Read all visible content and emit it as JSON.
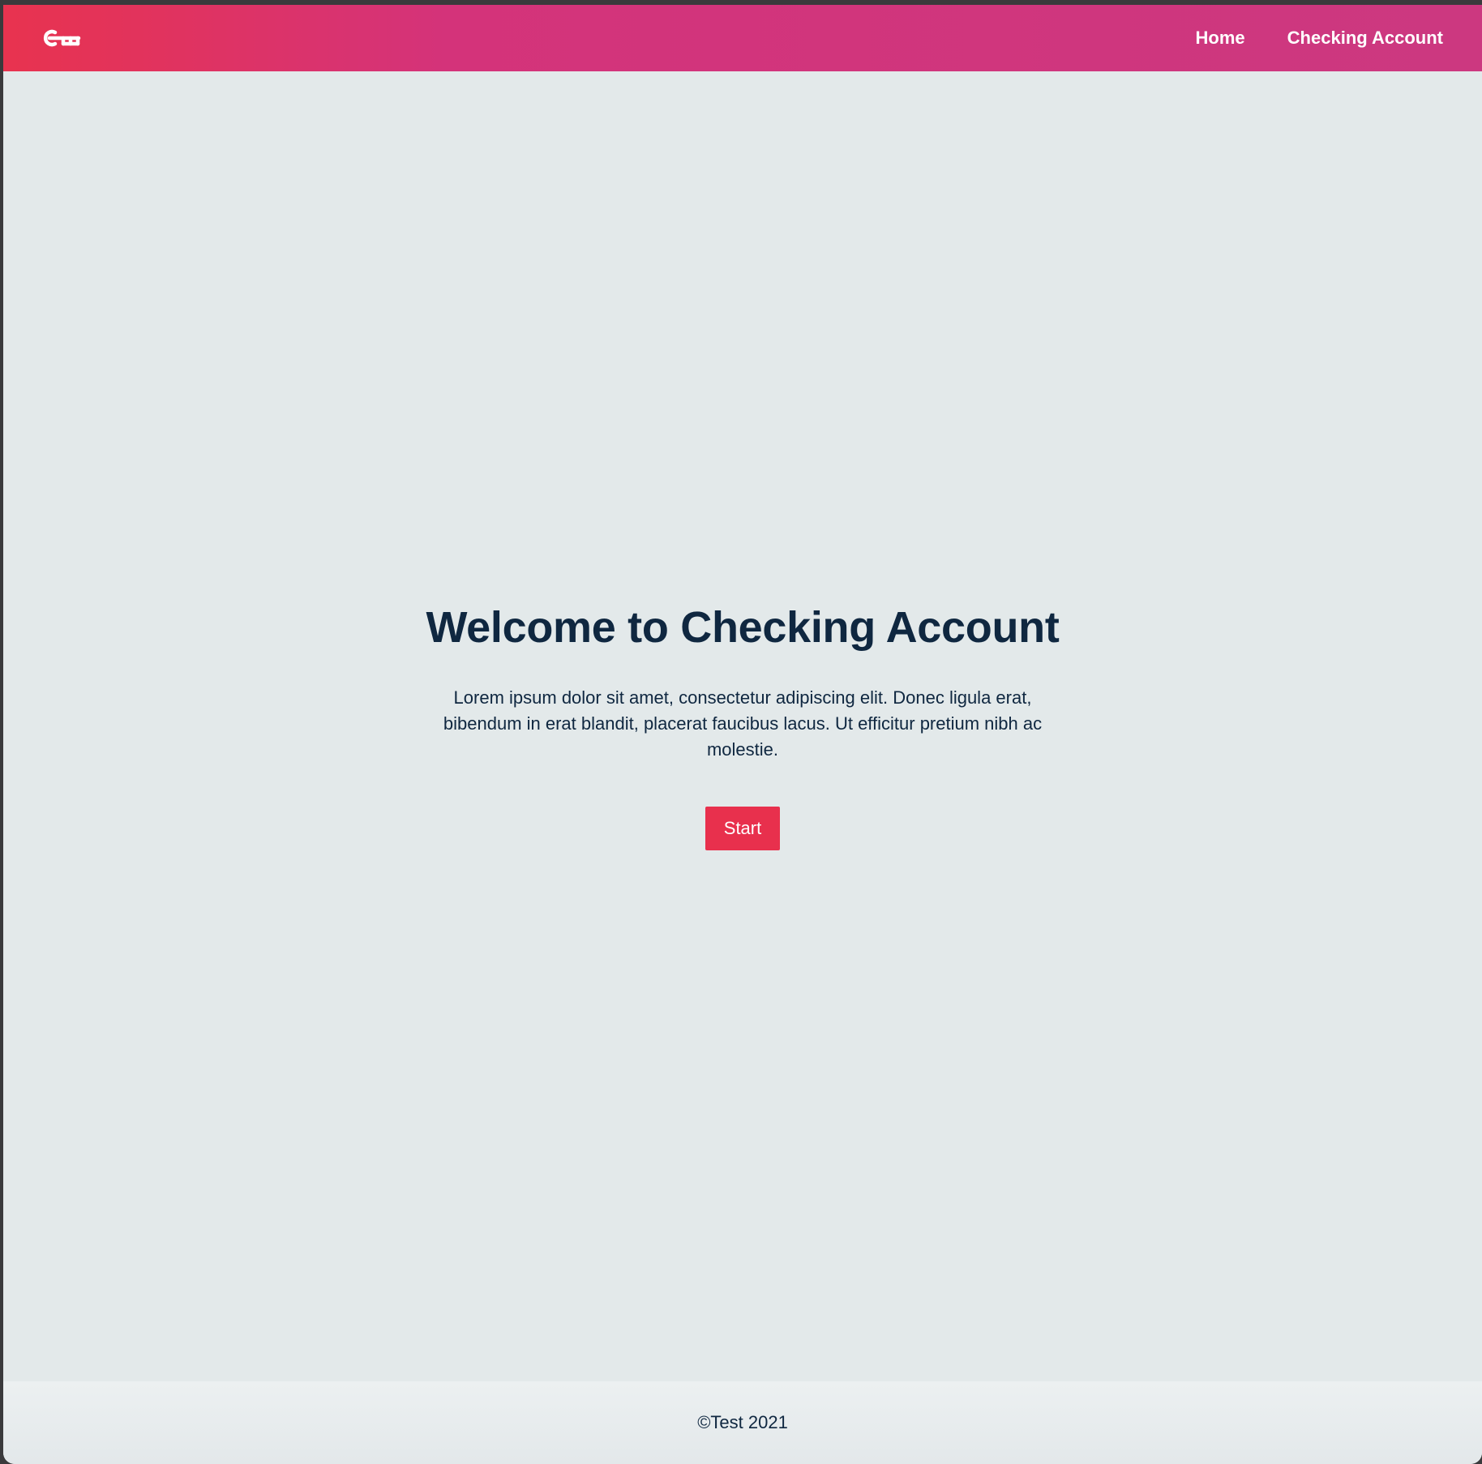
{
  "navbar": {
    "logo_icon": "key-icon",
    "links": [
      {
        "label": "Home"
      },
      {
        "label": "Checking Account"
      }
    ],
    "gradient_start": "#e8334f",
    "gradient_end": "#cc3880"
  },
  "hero": {
    "title": "Welcome to Checking Account",
    "text": "Lorem ipsum dolor sit amet, consectetur adipiscing elit. Donec ligula erat, bibendum in erat blandit, placerat faucibus lacus. Ut efficitur pretium nibh ac molestie.",
    "button_label": "Start",
    "button_color": "#e8304d"
  },
  "footer": {
    "text": "©Test 2021"
  },
  "colors": {
    "background": "#e3e9ea",
    "text": "#0f2740"
  }
}
